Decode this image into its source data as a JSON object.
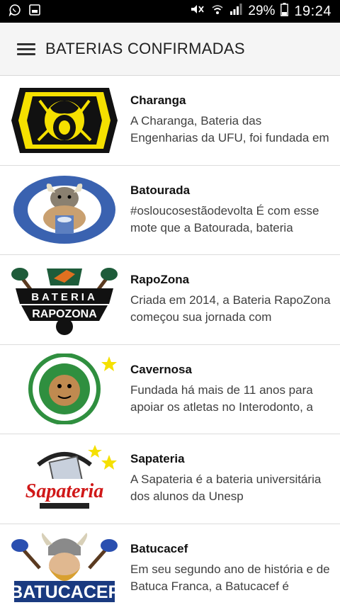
{
  "status": {
    "battery_percent": "29%",
    "time": "19:24"
  },
  "header": {
    "title": "BATERIAS CONFIRMADAS"
  },
  "items": [
    {
      "title": "Charanga",
      "description": "A Charanga, Bateria das Engenharias da UFU, foi fundada em"
    },
    {
      "title": "Batourada",
      "description": "#osloucosestãodevolta É com esse mote que a Batourada, bateria"
    },
    {
      "title": "RapoZona",
      "description": "Criada em 2014, a Bateria RapoZona começou sua jornada com"
    },
    {
      "title": "Cavernosa",
      "description": "Fundada há mais de 11 anos para apoiar os atletas no Interodonto, a"
    },
    {
      "title": "Sapateria",
      "description": "A Sapateria é a bateria universitária dos alunos da Unesp"
    },
    {
      "title": "Batucacef",
      "description": "Em seu segundo ano de história e de Batuca Franca, a Batucacef é"
    }
  ],
  "logo_text": {
    "rapozona_banner": "BATERIA",
    "rapozona_name": "RAPOZONA",
    "sapateria_name": "Sapateria",
    "batucacef_name": "BATUCACEF"
  },
  "colors": {
    "status_bar": "#000000",
    "app_bar": "#f5f5f5",
    "divider": "#dcdcdc",
    "title_text": "#111111",
    "desc_text": "#404040"
  }
}
